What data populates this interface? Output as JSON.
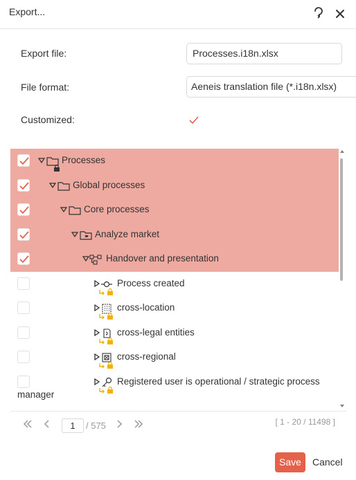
{
  "dialog": {
    "title": "Export...",
    "help_icon": "question-icon",
    "close_icon": "close-icon"
  },
  "form": {
    "export_file_label": "Export file:",
    "export_file_value": "Processes.i18n.xlsx",
    "file_format_label": "File format:",
    "file_format_value": "Aeneis translation file (*.i18n.xlsx)",
    "customized_label": "Customized:",
    "customized_checked": true
  },
  "tree": {
    "rows": [
      {
        "label": "Processes",
        "checked": true,
        "expanded": true,
        "icon": "folder-icon",
        "locked": true
      },
      {
        "label": "Global processes",
        "checked": true,
        "expanded": true,
        "icon": "folder-icon"
      },
      {
        "label": "Core processes",
        "checked": true,
        "expanded": true,
        "icon": "folder-icon"
      },
      {
        "label": "Analyze market",
        "checked": true,
        "expanded": true,
        "icon": "process-folder-icon"
      },
      {
        "label": "Handover and presentation",
        "checked": true,
        "expanded": true,
        "icon": "process-flow-icon"
      },
      {
        "label": "Process created",
        "checked": false,
        "expanded": false,
        "icon": "event-icon",
        "locked": true
      },
      {
        "label": "cross-location",
        "checked": false,
        "expanded": false,
        "icon": "building-icon",
        "locked": true
      },
      {
        "label": "cross-legal entities",
        "checked": false,
        "expanded": false,
        "icon": "legal-entity-icon",
        "locked": true
      },
      {
        "label": "cross-regional",
        "checked": false,
        "expanded": false,
        "icon": "region-icon",
        "locked": true
      },
      {
        "label": "Registered user is operational / strategic process",
        "label_cont": "manager",
        "checked": false,
        "expanded": false,
        "icon": "key-icon",
        "locked": true
      }
    ]
  },
  "pager": {
    "first_icon": "double-chevron-left-icon",
    "prev_icon": "chevron-left-icon",
    "next_icon": "chevron-right-icon",
    "last_icon": "double-chevron-right-icon",
    "page": "1",
    "total": "/ 575",
    "range": "[ 1 - 20 / 11498 ]"
  },
  "buttons": {
    "save": "Save",
    "cancel": "Cancel"
  },
  "colors": {
    "selected_row": "#eeaaa0",
    "accent": "#e4624a",
    "lock": "#f0b400"
  }
}
